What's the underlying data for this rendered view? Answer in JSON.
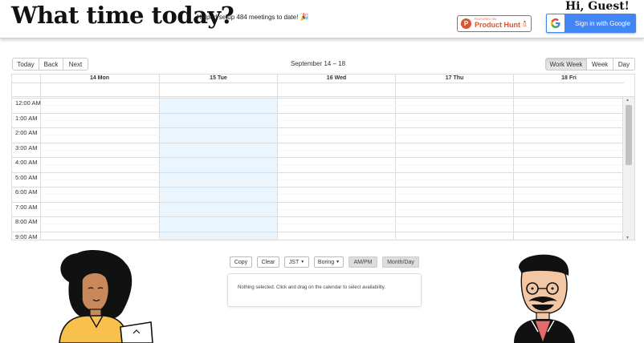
{
  "header": {
    "title": "What time today?",
    "tagline": "Helped setup 484 meetings to date!",
    "tagline_emoji": "🎉",
    "product_hunt": {
      "small": "FEATURED ON",
      "big": "Product Hunt",
      "arrow": "▲",
      "count": "11"
    },
    "greeting": "Hi, Guest!",
    "google": {
      "icon": "G",
      "label": "Sign in with Google"
    }
  },
  "nav": {
    "today": "Today",
    "back": "Back",
    "next": "Next"
  },
  "range_label": "September 14 – 18",
  "views": {
    "work_week": "Work Week",
    "week": "Week",
    "day": "Day"
  },
  "calendar": {
    "days": [
      "14 Mon",
      "15 Tue",
      "16 Wed",
      "17 Thu",
      "18 Fri"
    ],
    "times": [
      "12:00 AM",
      "1:00 AM",
      "2:00 AM",
      "3:00 AM",
      "4:00 AM",
      "5:00 AM",
      "6:00 AM",
      "7:00 AM",
      "8:00 AM",
      "9:00 AM"
    ]
  },
  "settings": {
    "copy": "Copy",
    "clear": "Clear",
    "timezone": "JST",
    "theme": "Boring",
    "ampm": "AM/PM",
    "monthday": "Month/Day"
  },
  "panel": {
    "message": "Nothing selected. Click and drag on the calendar to select availability."
  },
  "colors": {
    "accent_google": "#4285f4",
    "product_hunt": "#da552f",
    "today_highlight": "#eaf6ff"
  }
}
